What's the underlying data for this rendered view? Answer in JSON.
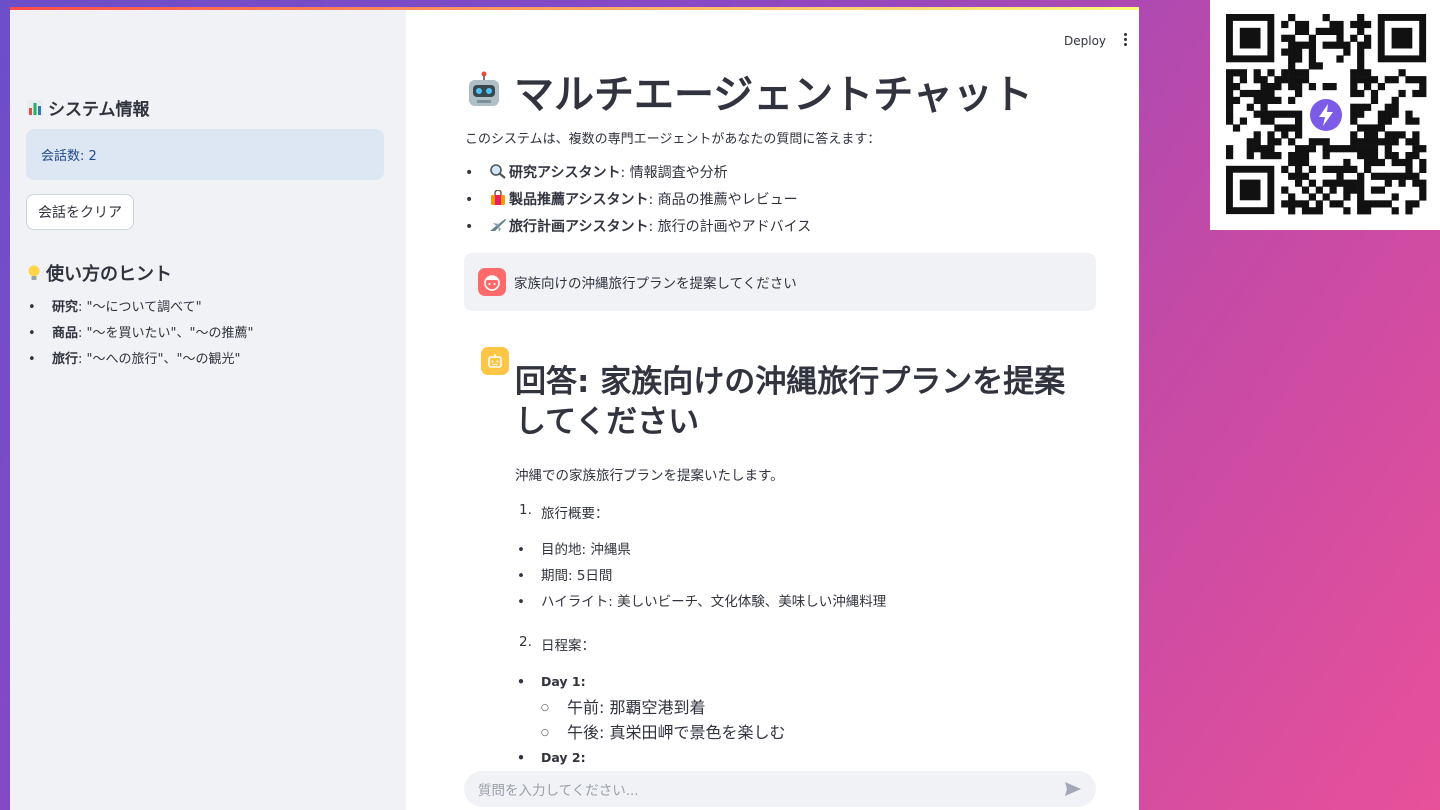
{
  "sidebar": {
    "system_heading": "システム情報",
    "session_count": "会話数: 2",
    "clear_button": "会話をクリア",
    "tips_heading": "使い方のヒント",
    "tips": [
      {
        "label": "研究",
        "text": ": \"〜について調べて\""
      },
      {
        "label": "商品",
        "text": ": \"〜を買いたい\"、\"〜の推薦\""
      },
      {
        "label": "旅行",
        "text": ": \"〜への旅行\"、\"〜の観光\""
      }
    ]
  },
  "header": {
    "deploy": "Deploy"
  },
  "main": {
    "title": "マルチエージェントチャット",
    "intro": "このシステムは、複数の専門エージェントがあなたの質問に答えます：",
    "agents": [
      {
        "icon": "magnifier-icon",
        "name": "研究アシスタント",
        "desc": ": 情報調査や分析"
      },
      {
        "icon": "shopping-bag-icon",
        "name": "製品推薦アシスタント",
        "desc": ": 商品の推薦やレビュー"
      },
      {
        "icon": "airplane-icon",
        "name": "旅行計画アシスタント",
        "desc": ": 旅行の計画やアドバイス"
      }
    ],
    "user_message": "家族向けの沖縄旅行プランを提案してください",
    "answer": {
      "heading": "回答: 家族向けの沖縄旅行プランを提案してください",
      "lead": "沖縄での家族旅行プランを提案いたします。",
      "sec1_num": "1.",
      "sec1_title": "旅行概要：",
      "overview": [
        "目的地: 沖縄県",
        "期間: 5日間",
        "ハイライト: 美しいビーチ、文化体験、美味しい沖縄料理"
      ],
      "sec2_num": "2.",
      "sec2_title": "日程案：",
      "day1": "Day 1:",
      "day1_items": [
        "午前: 那覇空港到着",
        "午後: 真栄田岬で景色を楽しむ"
      ],
      "day2": "Day 2:"
    },
    "chat_placeholder": "質問を入力してください..."
  },
  "colors": {
    "user_avatar": "#ff6b6b",
    "bot_avatar": "#ffc545",
    "info_box": "#dde6f3"
  }
}
